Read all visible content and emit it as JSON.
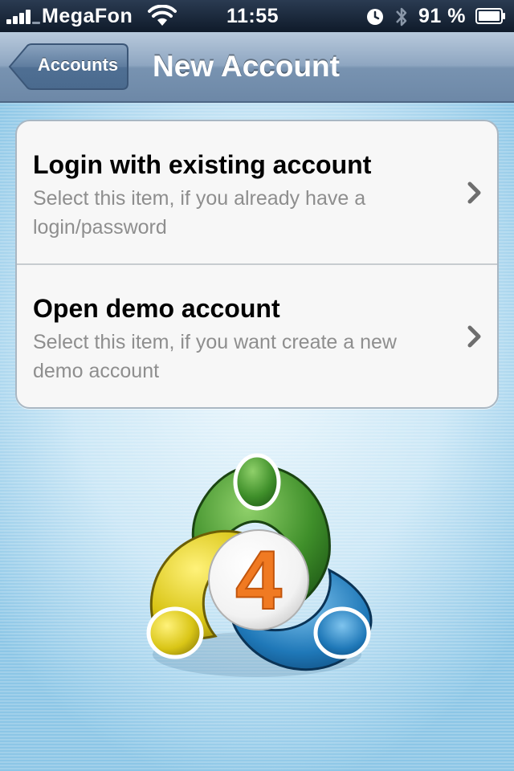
{
  "status_bar": {
    "carrier": "MegaFon",
    "time": "11:55",
    "battery": "91 %",
    "icons": [
      "signal-icon",
      "wifi-icon",
      "alarm-clock-icon",
      "bluetooth-icon",
      "battery-icon"
    ]
  },
  "nav": {
    "back_label": "Accounts",
    "title": "New Account"
  },
  "options": [
    {
      "title": "Login with existing account",
      "description": "Select this item, if you already have a login/password"
    },
    {
      "title": "Open demo account",
      "description": "Select this item, if you want create a new demo account"
    }
  ],
  "logo": {
    "digit": "4",
    "colors": {
      "green": "#3f8f2a",
      "yellow": "#d9c516",
      "blue": "#1f78b8",
      "orange": "#f07a22"
    }
  },
  "colors": {
    "nav_bar": "#7893b1",
    "background": "#c7e4f4",
    "row_text": "#000000",
    "row_subtext": "#8e8e8e"
  }
}
